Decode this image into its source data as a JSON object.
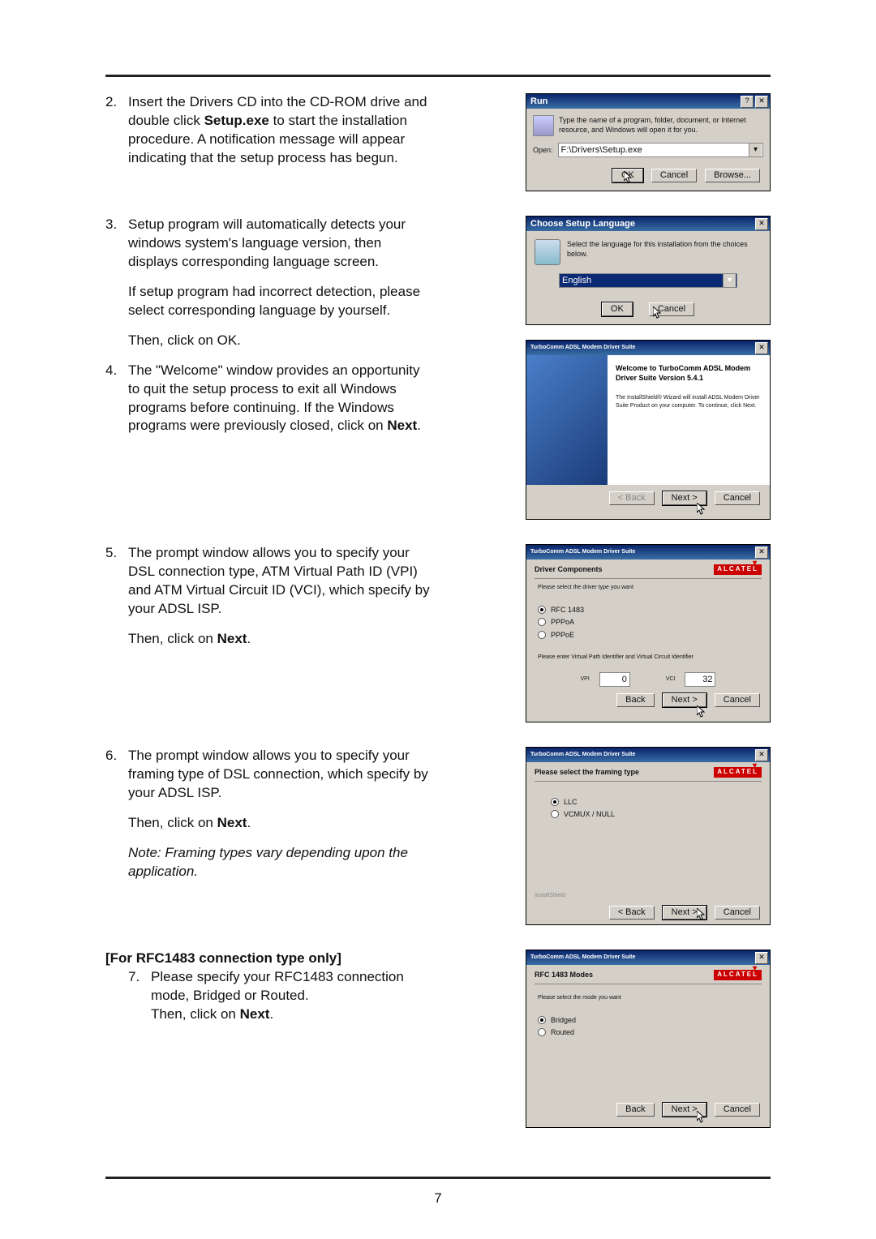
{
  "page_number": "7",
  "steps": {
    "s2": {
      "num": "2.",
      "text": "Insert the Drivers CD into the CD-ROM drive and double click Setup.exe to start the installation procedure. A notification message will appear indicating that the setup process has begun.",
      "emph": "Setup.exe"
    },
    "s3": {
      "num": "3.",
      "p1": "Setup program will automatically detects your windows system's language version, then displays corresponding language screen.",
      "p2": "If setup program had incorrect detection, please select corresponding language by yourself.",
      "p3": "Then, click on OK."
    },
    "s4": {
      "num": "4.",
      "text": "The \"Welcome\" window provides an opportunity to quit the setup process to exit all Windows programs before continuing. If the Windows programs were previously closed, click on Next.",
      "emph": "Next"
    },
    "s5": {
      "num": "5.",
      "p1": "The prompt window allows you to specify your DSL connection type, ATM Virtual Path ID (VPI) and ATM Virtual Circuit ID (VCI), which specify by your ADSL ISP.",
      "p2": "Then, click on Next.",
      "emph": "Next"
    },
    "s6": {
      "num": "6.",
      "p1": "The prompt window allows you to specify your framing type of DSL connection, which specify by your ADSL ISP.",
      "p2": "Then, click on Next.",
      "emph": "Next",
      "note": "Note: Framing types vary depending upon the application."
    },
    "s7": {
      "hdr": "[For RFC1483 connection type only]",
      "num": "7.",
      "p1": "Please specify your RFC1483 connection mode, Bridged or Routed.",
      "p2": "Then, click on Next.",
      "emph": "Next"
    }
  },
  "run": {
    "title": "Run",
    "help": "?",
    "close": "✕",
    "msg": "Type the name of a program, folder, document, or Internet resource, and Windows will open it for you.",
    "open": "Open:",
    "value": "F:\\Drivers\\Setup.exe",
    "ok": "OK",
    "cancel": "Cancel",
    "browse": "Browse..."
  },
  "lang": {
    "title": "Choose Setup Language",
    "close": "✕",
    "msg": "Select the language for this installation from the choices below.",
    "value": "English",
    "ok": "OK",
    "cancel": "Cancel"
  },
  "welcome": {
    "title": "TurboComm ADSL Modem Driver Suite",
    "close": "✕",
    "h": "Welcome to TurboComm ADSL Modem Driver Suite Version 5.4.1",
    "msg": "The InstallShield® Wizard will install ADSL Modem Driver Suite Product on your computer. To continue, click Next.",
    "back": "< Back",
    "next": "Next >",
    "cancel": "Cancel"
  },
  "comp": {
    "title": "TurboComm ADSL Modem Driver Suite",
    "close": "✕",
    "hdr": "Driver Components",
    "brand": "ALCATEL",
    "l1": "Please select the driver type you want",
    "r1": "RFC 1483",
    "r2": "PPPoA",
    "r3": "PPPoE",
    "l2": "Please enter Virtual Path Identifier and Virtual Circuit Identifier",
    "vpi": "VPI",
    "vpi_v": "0",
    "vci": "VCI",
    "vci_v": "32",
    "back": "Back",
    "next": "Next >",
    "cancel": "Cancel"
  },
  "fram": {
    "title": "TurboComm ADSL Modem Driver Suite",
    "close": "✕",
    "hdr": "Please select the framing type",
    "brand": "ALCATEL",
    "r1": "LLC",
    "r2": "VCMUX / NULL",
    "foot": "InstallShield",
    "back": "< Back",
    "next": "Next >",
    "cancel": "Cancel"
  },
  "modes": {
    "title": "TurboComm ADSL Modem Driver Suite",
    "close": "✕",
    "hdr": "RFC 1483 Modes",
    "brand": "ALCATEL",
    "l1": "Please select the mode you want",
    "r1": "Bridged",
    "r2": "Routed",
    "back": "Back",
    "next": "Next >",
    "cancel": "Cancel"
  }
}
